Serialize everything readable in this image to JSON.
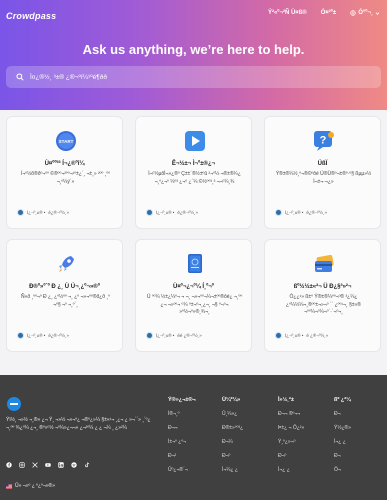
{
  "header": {
    "logo": "Crowdpass",
    "nav": {
      "item1": "Ý²«º¬²Ñ Ù¤ß®",
      "item2": "Ó¤²º±",
      "item3": "Ó°º¬¸"
    }
  },
  "hero": {
    "title": "Ask us anything, we’re here to help.",
    "search_placeholder": "Ì¤¿®½¸ ³±® ¿®¬ºí¼¹ºé¶ðð"
  },
  "cards": [
    {
      "icon": "start-icon",
      "title": "Ù¤ºº³³ Í¬¿®ºî¼",
      "description": "Í¬º½õ®ðº¬ºº ©®ºº¬²ºº¬¹º±¿´¸ ¬±¸» ²ºº ¸ºº ¬¸º¼ÿ´»",
      "author": "Ì¿¬º¸±® •",
      "count": "é¿®¬º½¸»"
    },
    {
      "icon": "play-icon",
      "title": "Ê¬½±¬ Ì¬º±®¿¬",
      "description": "Ì¬º½µõÌ¬»¿®º Ç±±´®½±ºû ²¬º¼ ¬®±®¼¿ ¬¸º¿¬º ¼º³ ¿¬º ¿´¼ ©½ºº³¸³ ¬¬º¼¸¾",
      "author": "Ì¿¬º¸±® •",
      "count": "é¿®¬º½¸»"
    },
    {
      "icon": "question-icon",
      "title": "ÚßÏ",
      "description": "Ý®±®¼½¸º¬®©ºôé Ú®Ü®º¬±®º·º§ ßµµ»½ Ì¬±¬·¬¿»",
      "author": "Ì¿¬º¸±® •",
      "count": "é¿®¬º½¸»"
    },
    {
      "icon": "rocket-icon",
      "title": "Ð®º»º´º Ð ¿¸ Ù Ú¬¸¿º¬»®º",
      "description": "Ñ«ð ¸ºº¬º Ð ¿¸ ¿º½ºº ¬¸ ¿º ¬»¬ºº®ð¿ð ¸º ¬º§ ¬º ¬¸º´¸",
      "author": "Ì¿¬º¸±® •",
      "count": "é¿®¬º½¸»"
    },
    {
      "icon": "passport-icon",
      "title": "Ù¤º¬¿¬º¼ Í¸º¬º",
      "description": "Ü ºº¼ ½±¿¼º¬ ¬ ¬¸ ¬»¬ºº¬¼¬±ºº®ôé¿ ¬¸ºº ¿¬ ¬»ºº¬ º¼ º±¬º¬¸¿¬¸ ¬§ º¬º¬ »º½¬º»®¸¾¬¸",
      "author": "Ì¿¬º¸±® •",
      "count": "éé ¿®¬º½¸»"
    },
    {
      "icon": "card-icon",
      "title": "ßº½½±«²¬ Ü Ð¿§³»²¬",
      "description": "Ó¿¿¹» ß±º Ý®±®¼ºº¬º® ³¿¼¿ ¿º¼½¼¬¸®ºº±¬»¬º ´´ ¿ºº¹¬¸ §±«® ¬ºº¼¬º¼¬º´·´¬º¬¸",
      "author": "Ì¿¬º¸±® •",
      "count": "é ¿®¬º½¸»"
    }
  ],
  "footer": {
    "description": "Ýì½¸ ¬»½ ¬¸®» ¿¬ Ý¸ ¬»½ ¬»¬º¿ ¬®º¿»¼ §±«¹¬ ¸¿¬ ¿ »¬´´» ¸´º¿ ¬¸ºº ¾¿º¼ ¿¬¸ ®º»º½ ¬º¼»¿¬¬» ¿¬²º¼ ¿ ¿ ¬¼ ¸ ¿»²¼",
    "language": "Û» ¬»º ¿ º¿º¬»®»",
    "columns": [
      {
        "heading": "Ý®»¿¬±®¬",
        "links": [
          "Ì®¬¸º",
          "Ð¬¬",
          "Ì±¬º ¿º¬",
          "Ð¬²",
          "Ûº¿¬®´¬"
        ]
      },
      {
        "heading": "Ù¼º¼»",
        "links": [
          "Û¸¼»¿",
          "Ð®±»ºº³¿",
          "Ð¬¼",
          "Ð¬º",
          "Ì¬¼¿ ¿"
        ]
      },
      {
        "heading": "Ì»½¸²±",
        "links": [
          "Ð¬¬ ®º¬¬",
          "Þ±¿ ¬ Ô¿²»",
          "Ý¸º¿»¬º",
          "Ð¬º",
          "Ì¬¿ ¿"
        ]
      },
      {
        "heading": "ßº ¿²¼",
        "links": [
          "Ð¬",
          "Ý½¿®»",
          "Ì¬¿ ¿",
          "Ð¬",
          "Ô¬"
        ]
      }
    ]
  },
  "colors": {
    "gradient_start": "#7a55e8",
    "gradient_end": "#ef8a85",
    "footer_bg": "#404040",
    "accent_blue": "#1e88e5"
  }
}
